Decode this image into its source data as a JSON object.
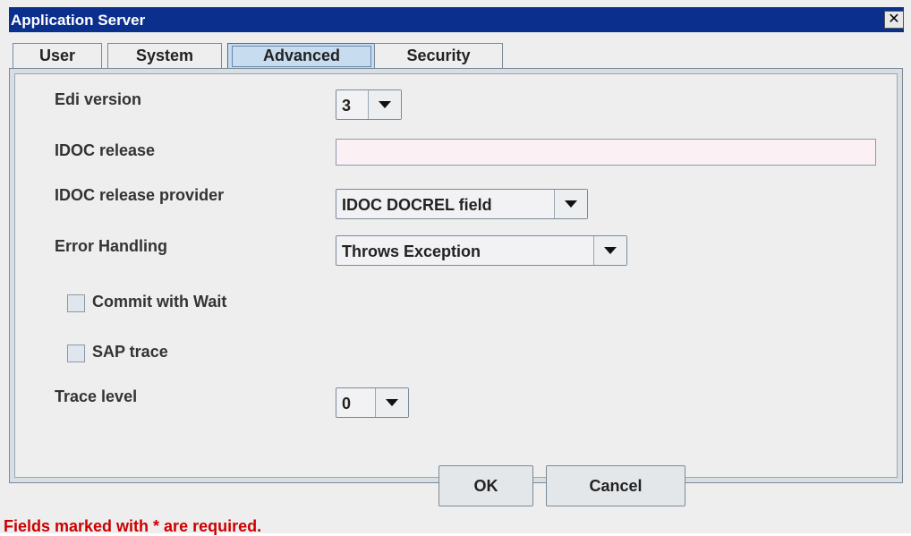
{
  "window": {
    "title": "Application Server",
    "close_glyph": "✕"
  },
  "tabs": [
    {
      "label": "User",
      "selected": false
    },
    {
      "label": "System",
      "selected": false
    },
    {
      "label": "Advanced",
      "selected": true
    },
    {
      "label": "Security",
      "selected": false
    }
  ],
  "form": {
    "edi_version": {
      "label": "Edi version",
      "value": "3"
    },
    "idoc_release": {
      "label": "IDOC release",
      "value": ""
    },
    "idoc_release_provider": {
      "label": "IDOC release provider",
      "value": "IDOC DOCREL field"
    },
    "error_handling": {
      "label": "Error Handling",
      "value": "Throws Exception"
    },
    "commit_with_wait": {
      "label": "Commit with Wait",
      "checked": false
    },
    "sap_trace": {
      "label": "SAP trace",
      "checked": false
    },
    "trace_level": {
      "label": "Trace level",
      "value": "0"
    }
  },
  "buttons": {
    "ok": "OK",
    "cancel": "Cancel"
  },
  "footer": {
    "required_note": "Fields marked with * are required."
  },
  "colors": {
    "titlebar": "#0b2f8c",
    "required_text": "#cc0000",
    "selected_tab": "#c8dcf0"
  }
}
